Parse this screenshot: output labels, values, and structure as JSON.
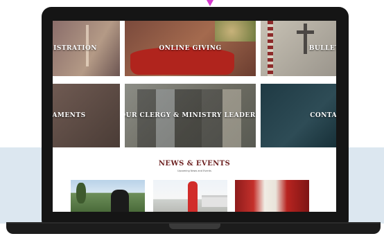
{
  "tiles": [
    {
      "id": "registration",
      "label": "GISTRATION"
    },
    {
      "id": "online-giving",
      "label": "ONLINE GIVING"
    },
    {
      "id": "bulletin",
      "label": "BULLETI"
    },
    {
      "id": "sacraments",
      "label": "AMENTS"
    },
    {
      "id": "clergy",
      "label": "OUR CLERGY & MINISTRY LEADERS"
    },
    {
      "id": "contact",
      "label": "CONTAC"
    }
  ],
  "news": {
    "title": "NEWS & EVENTS",
    "subtitle": "Upcoming News and Events"
  },
  "colors": {
    "accent": "#6b1f1f",
    "band": "#dce7f0",
    "laptop": "#151515"
  }
}
